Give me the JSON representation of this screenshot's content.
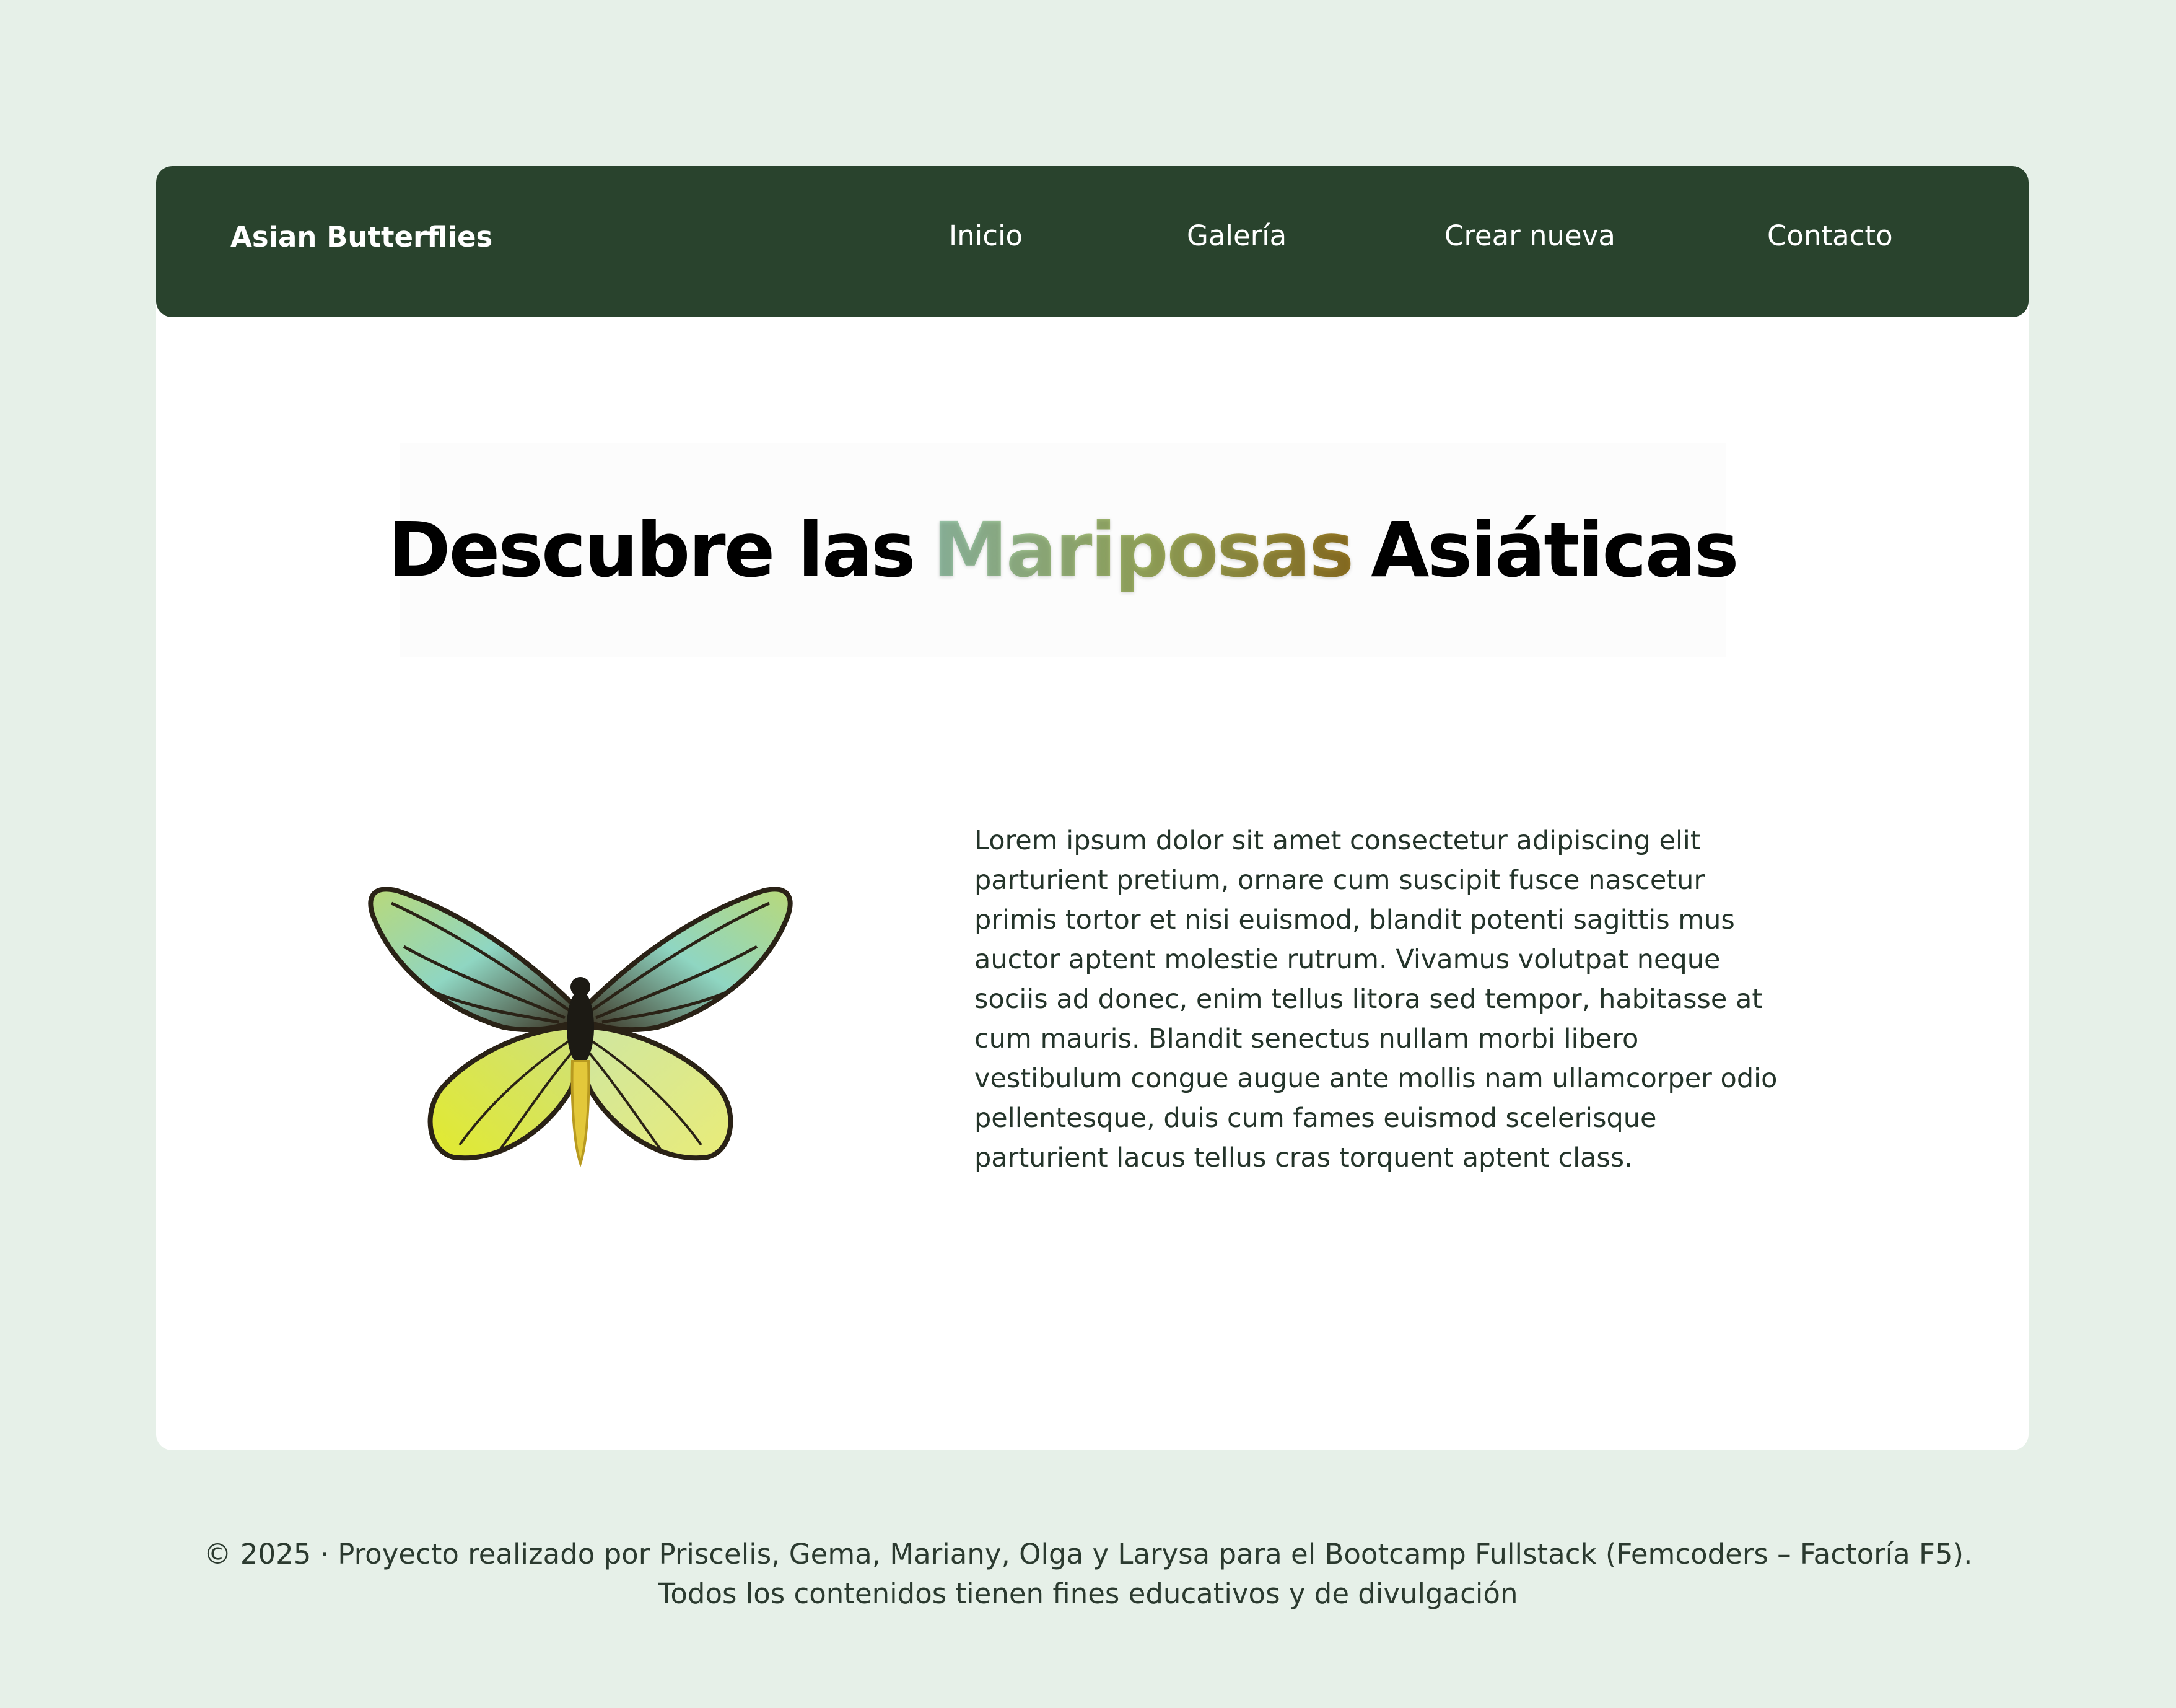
{
  "brand": "Asian Butterflies",
  "nav": {
    "items": [
      {
        "label": "Inicio"
      },
      {
        "label": "Galería"
      },
      {
        "label": "Crear nueva"
      },
      {
        "label": "Contacto"
      }
    ]
  },
  "hero": {
    "title_before": "Descubre las",
    "title_accent": "Mariposas",
    "title_after": "Asiáticas"
  },
  "content": {
    "image_alt_icon": "butterfly-image",
    "paragraph": "Lorem ipsum dolor sit amet consectetur adipiscing elit parturient pretium, ornare cum suscipit fusce nascetur primis tortor et nisi euismod, blandit potenti sagittis mus auctor aptent molestie rutrum. Vivamus volutpat neque sociis ad donec, enim tellus litora sed tempor, habitasse at cum mauris. Blandit senectus nullam morbi libero vestibulum congue augue ante mollis nam ullamcorper odio pellentesque, duis cum fames euismod scelerisque parturient lacus tellus cras torquent aptent class."
  },
  "footer": {
    "line1": "© 2025 · Proyecto realizado por Priscelis, Gema, Mariany, Olga y Larysa para el Bootcamp Fullstack (Femcoders – Factoría F5).",
    "line2": "Todos los contenidos tienen fines educativos y de divulgación"
  },
  "colors": {
    "page_bg": "#e6f0e8",
    "navbar_bg": "#29432d",
    "card_bg": "#ffffff",
    "accent_gradient_start": "#9dcbb0",
    "accent_gradient_end": "#9a7a24"
  }
}
